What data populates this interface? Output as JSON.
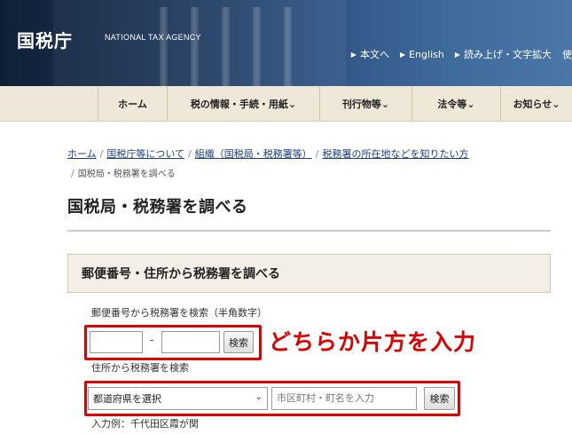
{
  "header": {
    "logo_jp": "国税庁",
    "logo_en": "NATIONAL TAX AGENCY",
    "util_links": [
      "本文へ",
      "English",
      "読み上げ・文字拡大",
      "使"
    ]
  },
  "nav": {
    "items": [
      "ホーム",
      "税の情報・手続・用紙",
      "刊行物等",
      "法令等",
      "お知らせ"
    ]
  },
  "breadcrumb": {
    "links": [
      "ホーム",
      "国税庁等について",
      "組織（国税局・税務署等）",
      "税務署の所在地などを知りたい方"
    ],
    "current": "国税局・税務署を調べる"
  },
  "page": {
    "title": "国税局・税務署を調べる",
    "section_title": "郵便番号・住所から税務署を調べる"
  },
  "postal_search": {
    "label": "郵便番号から税務署を検索（半角数字）",
    "zip_first": "",
    "zip_second": "",
    "dash": "-",
    "button_label": "検索"
  },
  "annotation": "どちらか片方を入力",
  "address_search": {
    "label": "住所から税務署を検索",
    "prefecture_selected": "都道府県を選択",
    "city_value": "",
    "city_placeholder": "市区町村・町名を入力",
    "button_label": "検索",
    "example": "入力例：千代田区霞が関"
  },
  "colors": {
    "highlight": "#e00000",
    "nav_bg": "#efe8d8",
    "link": "#1a3e8c"
  }
}
